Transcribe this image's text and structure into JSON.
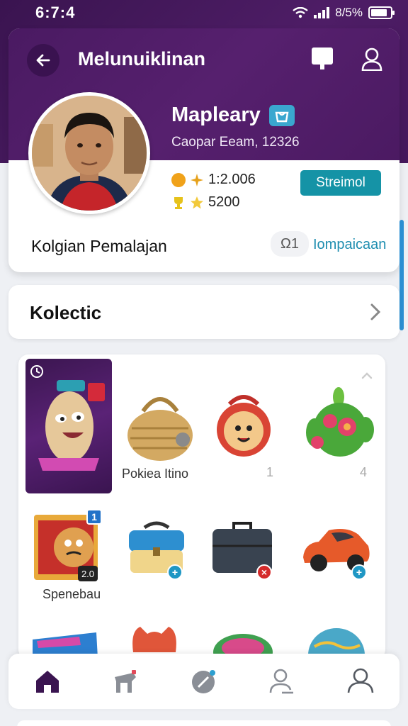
{
  "status_bar": {
    "time": "6:7:4",
    "battery_text": "8/5%",
    "battery_level": 0.85
  },
  "header": {
    "title": "Melunuiklinan",
    "back_icon": "arrow-left-icon",
    "chat_icon": "chat-bubble-icon",
    "profile_icon": "user-icon"
  },
  "profile": {
    "name": "Mapleary",
    "subtitle": "Caopar Eeam, 12326",
    "coins": "1:2.006",
    "stars": "5200",
    "follow_label": "Streimol",
    "section_label": "Kolgian Pemalajan",
    "id_chip": "Ω1",
    "id_link": "Iompaicaan"
  },
  "collection": {
    "title": "Kolectic"
  },
  "items": {
    "row1_label": "Pokiea Itino",
    "row1_count_a": "1",
    "row1_count_b": "4",
    "row2_label": "Spenebau",
    "row2_box_badge": "2.0"
  },
  "colors": {
    "purple": "#4e1d66",
    "teal": "#1593a6",
    "link": "#1f8eb0"
  },
  "nav": {
    "items": [
      "home-icon",
      "gift-icon",
      "pen-icon",
      "user-edit-icon",
      "friends-icon"
    ]
  }
}
